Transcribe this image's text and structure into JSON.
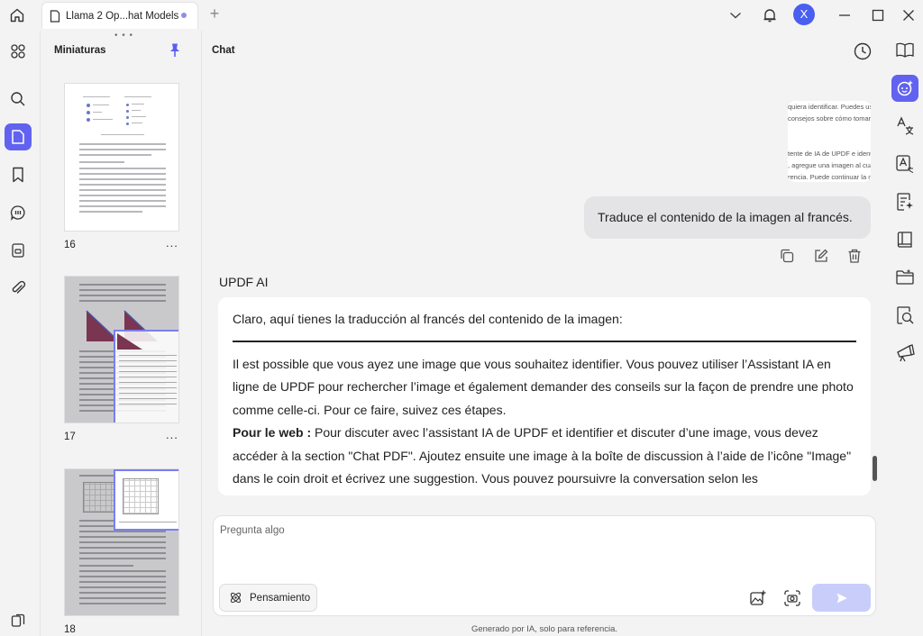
{
  "window": {
    "tab_title": "Llama 2 Op...hat Models",
    "new_tab_symbol": "+",
    "avatar_initial": "X"
  },
  "left_rail": {
    "icons": [
      "grid-icon",
      "search-icon",
      "page-icon",
      "bookmark-icon",
      "comment-icon",
      "stamp-icon",
      "attachment-icon",
      "layers-icon"
    ],
    "active": "page-icon"
  },
  "thumbnails": {
    "header": "Miniaturas",
    "grip": "• • •",
    "pages": [
      {
        "number": "16",
        "more": "..."
      },
      {
        "number": "17",
        "more": "..."
      },
      {
        "number": "18",
        "more": "..."
      }
    ]
  },
  "chat": {
    "title": "Chat",
    "image_preview_lines": [
      "quiera identificar. Puedes us",
      "consejos sobre cómo tomar u",
      "",
      "",
      "tente de IA de UPDF e identif",
      ", agregue una imagen al cuad",
      "rencia. Puede continuar la co"
    ],
    "user_message": "Traduce el contenido de la imagen al francés.",
    "ai_label": "UPDF AI",
    "ai_intro": "Claro, aquí tienes la traducción al francés del contenido de la imagen:",
    "ai_paragraph_1": "Il est possible que vous ayez une image que vous souhaitez identifier. Vous pouvez utiliser l’Assistant IA en ligne de UPDF pour rechercher l’image et également demander des conseils sur la façon de prendre une photo comme celle-ci. Pour ce faire, suivez ces étapes.",
    "ai_paragraph_2_bold": "Pour le web :",
    "ai_paragraph_2": " Pour discuter avec l’assistant IA de UPDF et identifier et discuter d’une image, vous devez accéder à la section \"Chat PDF\". Ajoutez ensuite une image à la boîte de discussion à l’aide de l’icône \"Image\" dans le coin droit et écrivez une suggestion. Vous pouvez poursuivre la conversation selon les",
    "input_placeholder": "Pregunta algo",
    "thinking_label": "Pensamiento",
    "footer_note": "Generado por IA, solo para referencia."
  },
  "right_rail": {
    "icons": [
      "book-open-icon",
      "ai-assistant-icon",
      "translate-icon",
      "ocr-icon",
      "summarize-icon",
      "book-icon",
      "folder-icon",
      "search-doc-icon",
      "presentation-icon"
    ],
    "active": "ai-assistant-icon"
  },
  "colors": {
    "accent": "#6262f0",
    "avatar": "#4a5ef0",
    "send_disabled": "#c9cdfa",
    "background": "#f3f3f4"
  }
}
